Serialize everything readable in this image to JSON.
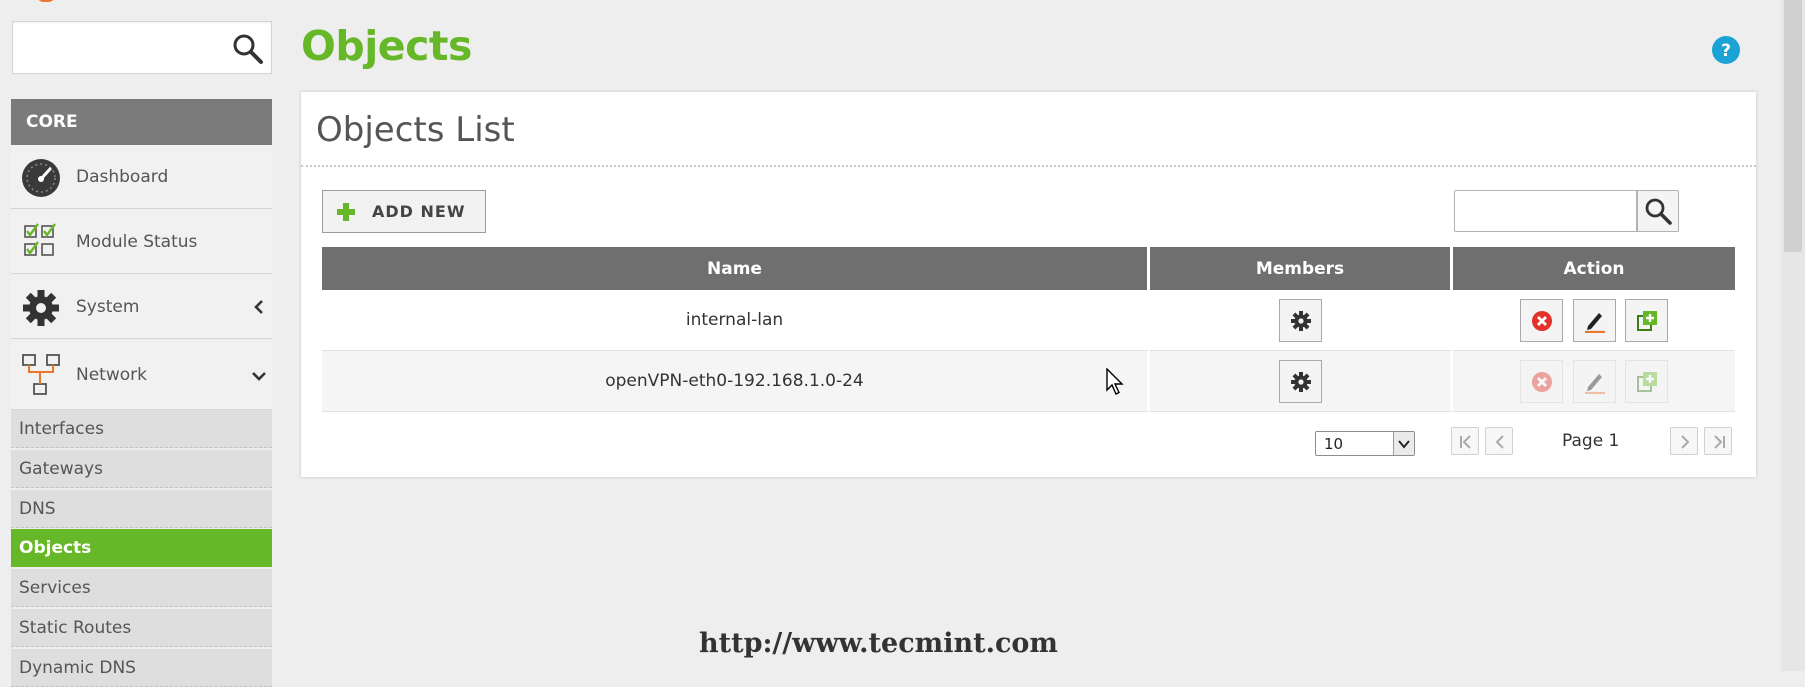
{
  "page": {
    "title": "Objects"
  },
  "sidebar": {
    "search": {
      "placeholder": ""
    },
    "section_title": "CORE",
    "menu": [
      {
        "label": "Dashboard",
        "icon": "dashboard-gauge-icon"
      },
      {
        "label": "Module Status",
        "icon": "checklist-icon"
      },
      {
        "label": "System",
        "icon": "gear-icon",
        "chevron": "chevron-left-icon"
      },
      {
        "label": "Network",
        "icon": "network-icon",
        "chevron": "chevron-down-icon"
      }
    ],
    "submenu": [
      {
        "label": "Interfaces",
        "active": false
      },
      {
        "label": "Gateways",
        "active": false
      },
      {
        "label": "DNS",
        "active": false
      },
      {
        "label": "Objects",
        "active": true
      },
      {
        "label": "Services",
        "active": false
      },
      {
        "label": "Static Routes",
        "active": false
      },
      {
        "label": "Dynamic DNS",
        "active": false
      }
    ]
  },
  "panel": {
    "title": "Objects List",
    "add_button_label": "ADD NEW",
    "search": {
      "placeholder": ""
    }
  },
  "table": {
    "columns": [
      "Name",
      "Members",
      "Action"
    ],
    "rows": [
      {
        "name": "internal-lan",
        "actions_enabled": true
      },
      {
        "name": "openVPN-eth0-192.168.1.0-24",
        "actions_enabled": false
      }
    ]
  },
  "pager": {
    "page_size": "10",
    "page_label": "Page 1"
  },
  "watermark": "http://www.tecmint.com",
  "colors": {
    "accent_green": "#67b829",
    "header_gray": "#6f6f6f",
    "help_blue": "#1ba3d6",
    "delete_red": "#e2322b"
  }
}
